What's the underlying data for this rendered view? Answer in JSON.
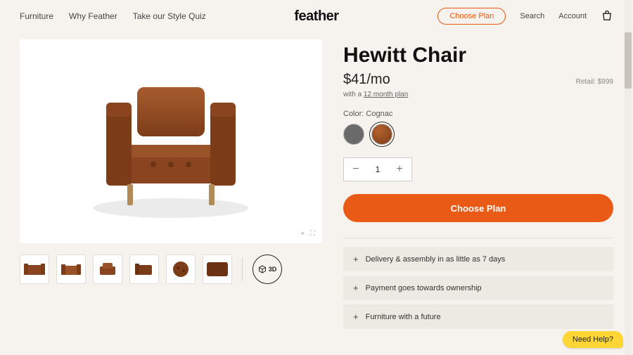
{
  "nav": {
    "links": [
      "Furniture",
      "Why Feather",
      "Take our Style Quiz"
    ],
    "logo": "feather",
    "choose_plan": "Choose Plan",
    "search": "Search",
    "account": "Account"
  },
  "product": {
    "title": "Hewitt Chair",
    "price": "$41/mo",
    "retail": "Retail: $999",
    "plan_prefix": "with a ",
    "plan_link": "12 month plan",
    "color_label": "Color: ",
    "color_value": "Cognac",
    "swatches": [
      {
        "name": "grey",
        "selected": false
      },
      {
        "name": "cognac",
        "selected": true
      }
    ],
    "quantity": "1",
    "cta": "Choose Plan",
    "thumb_3d": "3D"
  },
  "accordion": [
    "Delivery & assembly in as little as 7 days",
    "Payment goes towards ownership",
    "Furniture with a future"
  ],
  "help": "Need Help?",
  "colors": {
    "accent": "#ea5a17",
    "cognac": "#8a4520"
  }
}
